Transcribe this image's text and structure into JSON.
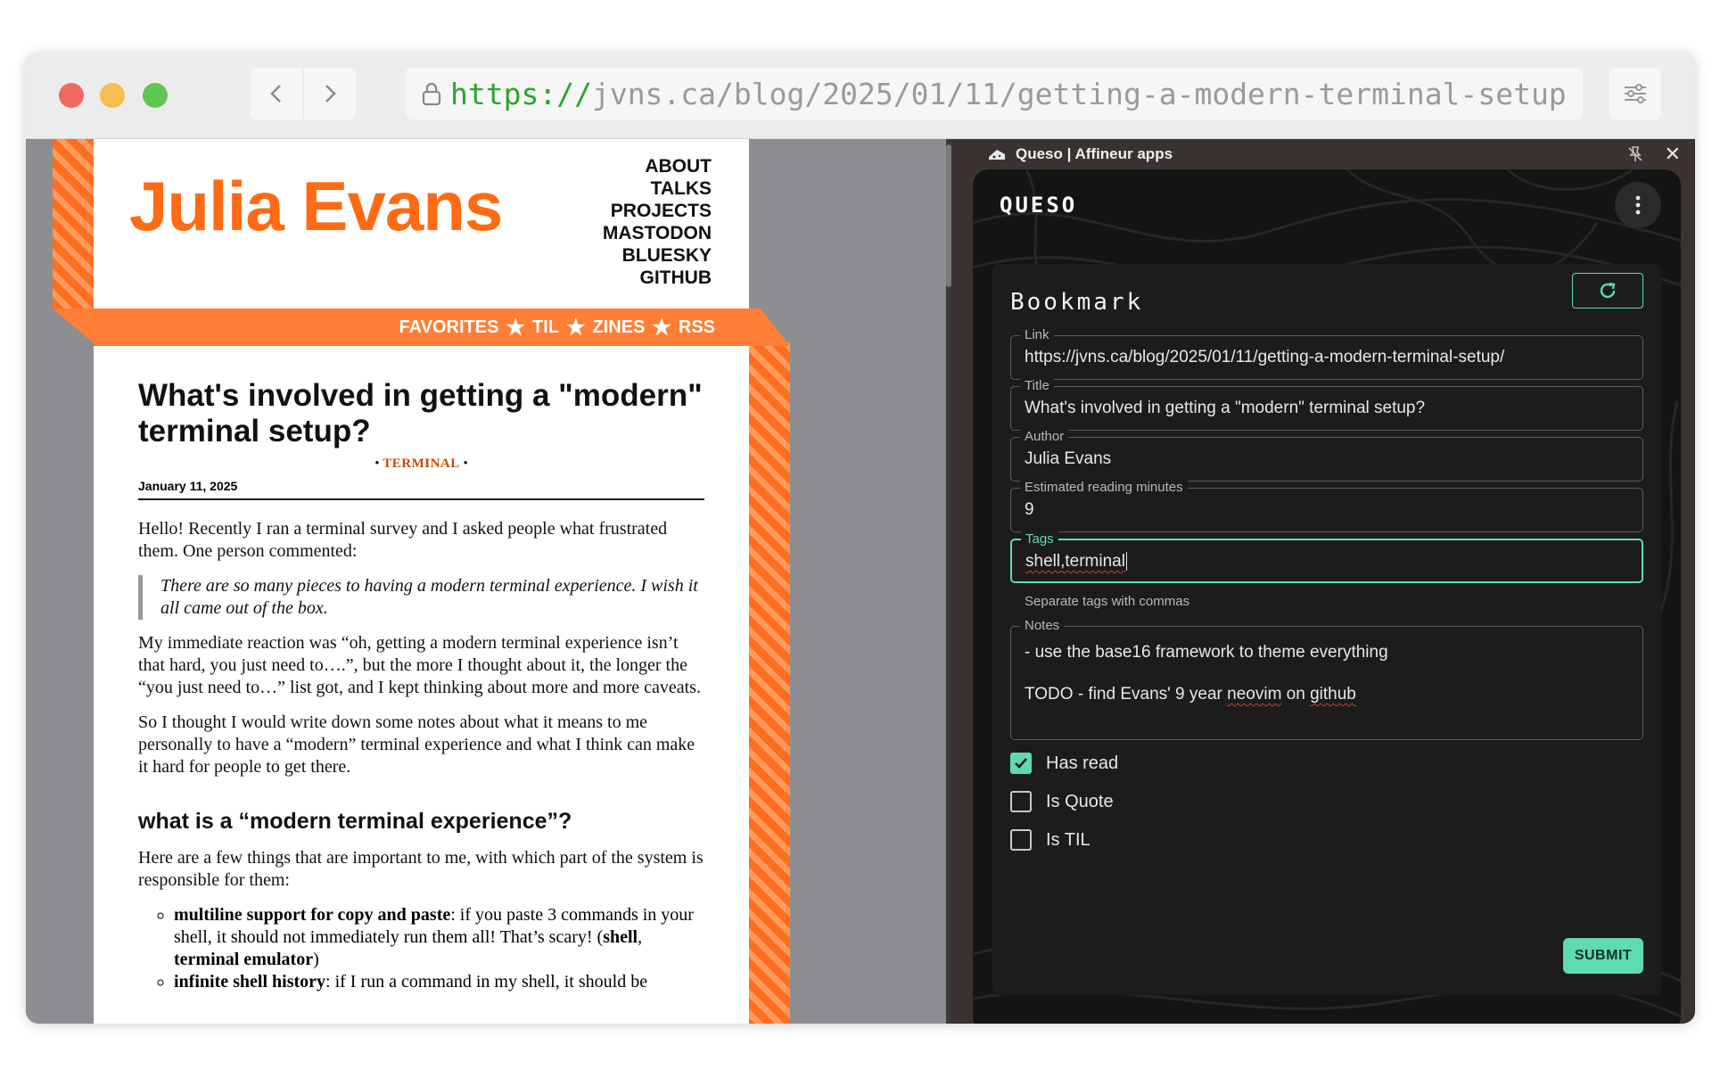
{
  "browser": {
    "url_scheme": "https://",
    "url_rest": "jvns.ca/blog/2025/01/11/getting-a-modern-terminal-setup"
  },
  "blog": {
    "site_title": "Julia Evans",
    "nav": [
      "ABOUT",
      "TALKS",
      "PROJECTS",
      "MASTODON",
      "BLUESKY",
      "GITHUB"
    ],
    "band_links": [
      "FAVORITES",
      "TIL",
      "ZINES",
      "RSS"
    ],
    "post_title": "What's involved in getting a \"modern\" terminal setup?",
    "tag": "TERMINAL",
    "date": "January 11, 2025",
    "intro": "Hello! Recently I ran a terminal survey and I asked people what frustrated them. One person commented:",
    "quote": "There are so many pieces to having a modern terminal experience. I wish it all came out of the box.",
    "para2": "My immediate reaction was “oh, getting a modern terminal experience isn’t that hard, you just need to….”, but the more I thought about it, the longer the “you just need to…” list got, and I kept thinking about more and more caveats.",
    "para3": "So I thought I would write down some notes about what it means to me personally to have a “modern” terminal experience and what I think can make it hard for people to get there.",
    "heading": "what is a “modern terminal experience”?",
    "para4": "Here are a few things that are important to me, with which part of the system is responsible for them:",
    "list": [
      {
        "bold": "multiline support for copy and paste",
        "text": ": if you paste 3 commands in your shell, it should not immediately run them all! That’s scary! (",
        "b1": "shell",
        "sep": ", ",
        "b2": "terminal emulator",
        "end": ")"
      },
      {
        "bold": "infinite shell history",
        "text": ": if I run a command in my shell, it should be"
      }
    ]
  },
  "app": {
    "window_title": "Queso | Affineur apps",
    "brand": "QUESO",
    "card_title": "Bookmark",
    "fields": {
      "link_label": "Link",
      "link_value": "https://jvns.ca/blog/2025/01/11/getting-a-modern-terminal-setup/",
      "title_label": "Title",
      "title_value": "What's involved in getting a \"modern\" terminal setup?",
      "author_label": "Author",
      "author_value": "Julia Evans",
      "minutes_label": "Estimated reading minutes",
      "minutes_value": "9",
      "tags_label": "Tags",
      "tags_value": "shell,terminal",
      "tags_helper": "Separate tags with commas",
      "notes_label": "Notes",
      "notes_line1": "- use the base16 framework to theme everything",
      "notes_line2_a": "TODO - find Evans' 9 year ",
      "notes_line2_b": "neovim",
      "notes_line2_c": " on ",
      "notes_line2_d": "github"
    },
    "checkboxes": [
      {
        "label": "Has read",
        "checked": true
      },
      {
        "label": "Is Quote",
        "checked": false
      },
      {
        "label": "Is TIL",
        "checked": false
      }
    ],
    "submit_label": "SUBMIT",
    "accent_color": "#5fdbb0"
  }
}
